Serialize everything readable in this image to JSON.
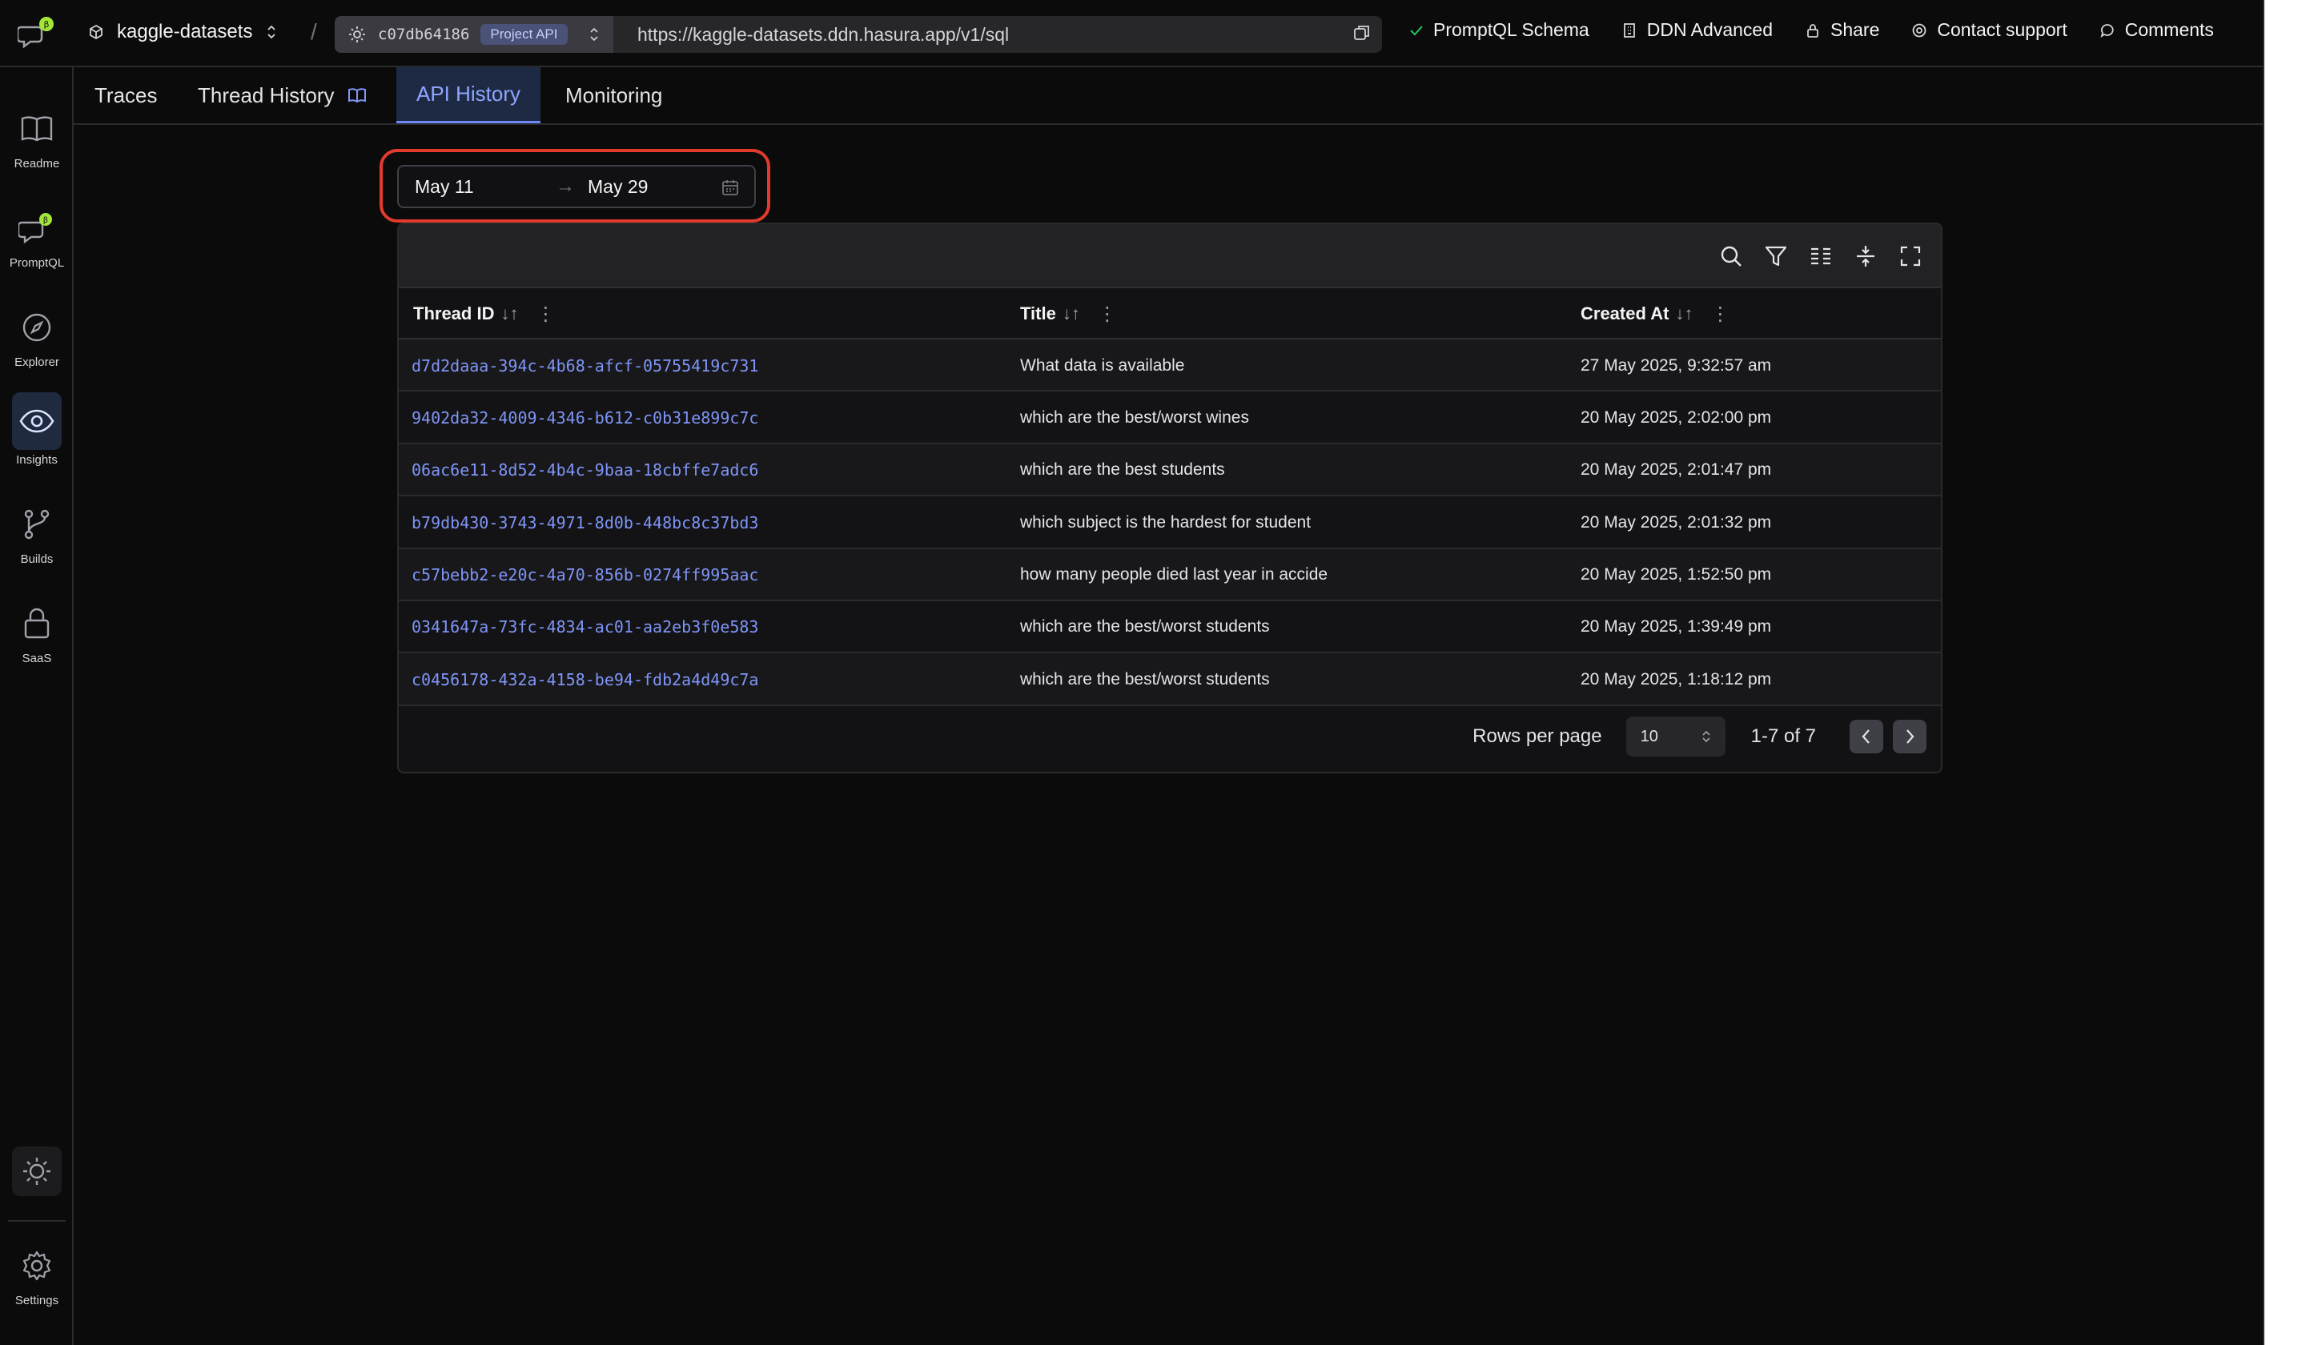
{
  "topbar": {
    "project_name": "kaggle-datasets",
    "separator": "/",
    "build_id": "c07db64186",
    "api_badge": "Project API",
    "api_url": "https://kaggle-datasets.ddn.hasura.app/v1/sql",
    "actions": [
      {
        "label": "PromptQL Schema",
        "icon": "check-icon"
      },
      {
        "label": "DDN Advanced",
        "icon": "building-icon"
      },
      {
        "label": "Share",
        "icon": "lock-icon"
      },
      {
        "label": "Contact support",
        "icon": "support-icon"
      },
      {
        "label": "Comments",
        "icon": "comment-icon"
      }
    ],
    "brand_badge": "β"
  },
  "rail": {
    "items": [
      {
        "label": "Readme",
        "icon": "book-icon"
      },
      {
        "label": "PromptQL",
        "icon": "chat-icon",
        "badge": "β"
      },
      {
        "label": "Explorer",
        "icon": "compass-icon"
      },
      {
        "label": "Insights",
        "icon": "eye-icon",
        "active": true
      },
      {
        "label": "Builds",
        "icon": "git-branch-icon"
      },
      {
        "label": "SaaS",
        "icon": "lock-icon"
      }
    ],
    "settings_label": "Settings"
  },
  "tabs": [
    {
      "label": "Traces"
    },
    {
      "label": "Thread History",
      "icon": "book-icon"
    },
    {
      "label": "API History",
      "active": true
    },
    {
      "label": "Monitoring"
    }
  ],
  "date_range": {
    "from": "May 11",
    "arrow": "→",
    "to": "May 29"
  },
  "table": {
    "columns": [
      {
        "label": "Thread ID"
      },
      {
        "label": "Title"
      },
      {
        "label": "Created At"
      }
    ],
    "sort_glyph": "↓↑",
    "menu_glyph": "⋮",
    "rows": [
      {
        "thread_id": "d7d2daaa-394c-4b68-afcf-05755419c731",
        "title": "What data is available",
        "created_at": "27 May 2025, 9:32:57 am"
      },
      {
        "thread_id": "9402da32-4009-4346-b612-c0b31e899c7c",
        "title": "which are the best/worst wines",
        "created_at": "20 May 2025, 2:02:00 pm"
      },
      {
        "thread_id": "06ac6e11-8d52-4b4c-9baa-18cbffe7adc6",
        "title": "which are the best students",
        "created_at": "20 May 2025, 2:01:47 pm"
      },
      {
        "thread_id": "b79db430-3743-4971-8d0b-448bc8c37bd3",
        "title": "which subject is the hardest for student",
        "created_at": "20 May 2025, 2:01:32 pm"
      },
      {
        "thread_id": "c57bebb2-e20c-4a70-856b-0274ff995aac",
        "title": "how many people died last year in accide",
        "created_at": "20 May 2025, 1:52:50 pm"
      },
      {
        "thread_id": "0341647a-73fc-4834-ac01-aa2eb3f0e583",
        "title": "which are the best/worst students",
        "created_at": "20 May 2025, 1:39:49 pm"
      },
      {
        "thread_id": "c0456178-432a-4158-be94-fdb2a4d49c7a",
        "title": "which are the best/worst students",
        "created_at": "20 May 2025, 1:18:12 pm"
      }
    ],
    "rows_per_page_label": "Rows per page",
    "rows_per_page_value": "10",
    "page_info": "1-7 of 7"
  },
  "colors": {
    "background": "#0b0b0b",
    "accent": "#7f95f7",
    "active_tab_bg": "#1e2a44",
    "highlight": "#e23b2e",
    "badge_green": "#a3e635"
  }
}
